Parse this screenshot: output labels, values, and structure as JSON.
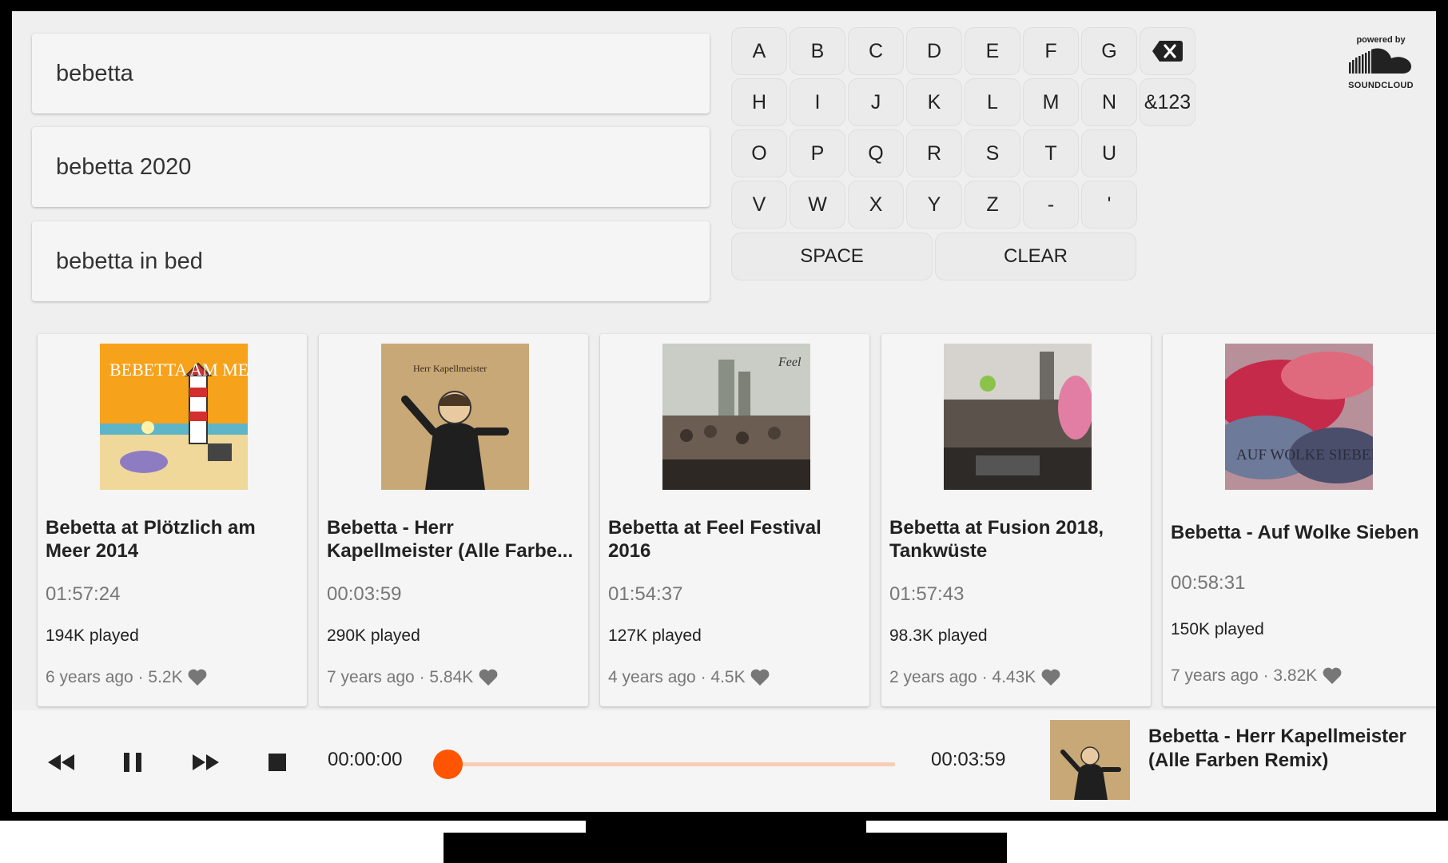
{
  "search": {
    "suggestions": [
      "bebetta",
      "bebetta 2020",
      "bebetta in bed"
    ]
  },
  "keyboard": {
    "row1": [
      "A",
      "B",
      "C",
      "D",
      "E",
      "F",
      "G"
    ],
    "row2": [
      "H",
      "I",
      "J",
      "K",
      "L",
      "M",
      "N",
      "&123"
    ],
    "row3": [
      "O",
      "P",
      "Q",
      "R",
      "S",
      "T",
      "U"
    ],
    "row4": [
      "V",
      "W",
      "X",
      "Y",
      "Z",
      "-",
      "'"
    ],
    "space_label": "SPACE",
    "clear_label": "CLEAR",
    "backspace_icon": "backspace-icon"
  },
  "branding": {
    "powered_by": "powered by",
    "name": "SOUNDCLOUD",
    "accent": "#ff5500"
  },
  "tracks": [
    {
      "title": "Bebetta at Plötzlich am Meer 2014",
      "duration": "01:57:24",
      "plays": "194K played",
      "meta": "6 years ago · 5.2K",
      "art_text": "BEBETTA AM MEER"
    },
    {
      "title": "Bebetta - Herr Kapellmeister (Alle Farbe...",
      "duration": "00:03:59",
      "plays": "290K played",
      "meta": "7 years ago · 5.84K",
      "art_text": "Herr Kapellmeister"
    },
    {
      "title": "Bebetta at Feel Festival 2016",
      "duration": "01:54:37",
      "plays": "127K played",
      "meta": "4 years ago · 4.5K",
      "art_text": "Feel"
    },
    {
      "title": "Bebetta at Fusion 2018, Tankwüste",
      "duration": "01:57:43",
      "plays": "98.3K played",
      "meta": "2 years ago · 4.43K",
      "art_text": ""
    },
    {
      "title": "Bebetta - Auf Wolke Sieben",
      "duration": "00:58:31",
      "plays": "150K played",
      "meta": "7 years ago · 3.82K",
      "art_text": "AUF WOLKE SIEBEN"
    }
  ],
  "player": {
    "current_time": "00:00:00",
    "total_time": "00:03:59",
    "progress": 0,
    "now_playing_title": "Bebetta - Herr Kapellmeister (Alle Farben Remix)",
    "buttons": [
      "rewind-icon",
      "pause-icon",
      "fast-forward-icon",
      "stop-icon"
    ]
  }
}
